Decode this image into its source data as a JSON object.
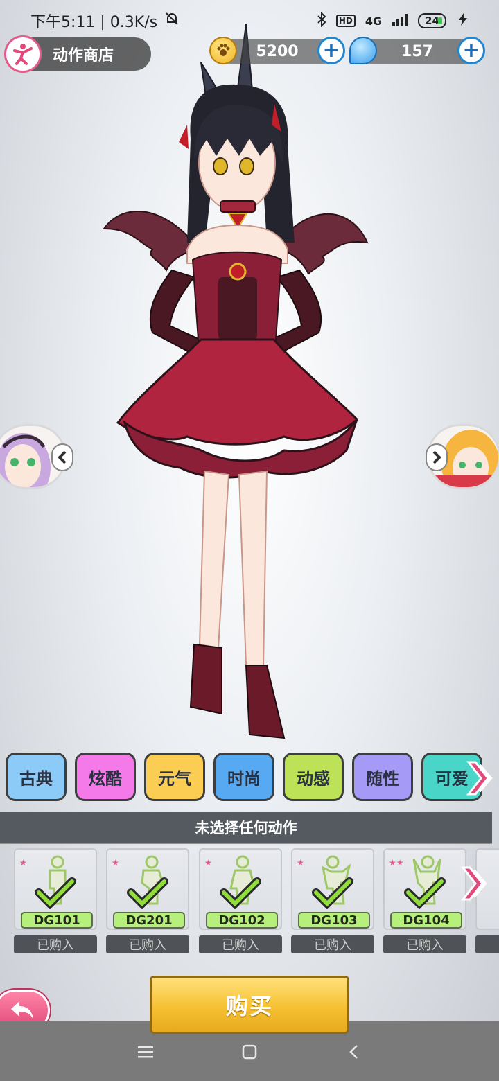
{
  "status_bar": {
    "time_speed": "下午5:11 | 0.3K/s",
    "network": "4G",
    "hd": "HD",
    "battery": "24"
  },
  "header": {
    "title": "动作商店",
    "coins": "5200",
    "gems": "157"
  },
  "categories": [
    {
      "label": "古典",
      "color": "#8ccaf7"
    },
    {
      "label": "炫酷",
      "color": "#f37ae8"
    },
    {
      "label": "元气",
      "color": "#fbcd52"
    },
    {
      "label": "时尚",
      "color": "#57a9f2"
    },
    {
      "label": "动感",
      "color": "#bde258"
    },
    {
      "label": "随性",
      "color": "#a59bf6"
    },
    {
      "label": "可爱",
      "color": "#49d6c9"
    }
  ],
  "selection_banner": "未选择任何动作",
  "actions": [
    {
      "code": "DG101",
      "status": "已购入"
    },
    {
      "code": "DG201",
      "status": "已购入"
    },
    {
      "code": "DG102",
      "status": "已购入"
    },
    {
      "code": "DG103",
      "status": "已购入"
    },
    {
      "code": "DG104",
      "status": "已购入"
    }
  ],
  "buy_button": "购买",
  "colors": {
    "accent_pink": "#e14a7a",
    "buy_yellow": "#f6c133",
    "code_green": "#b6ef7c"
  }
}
